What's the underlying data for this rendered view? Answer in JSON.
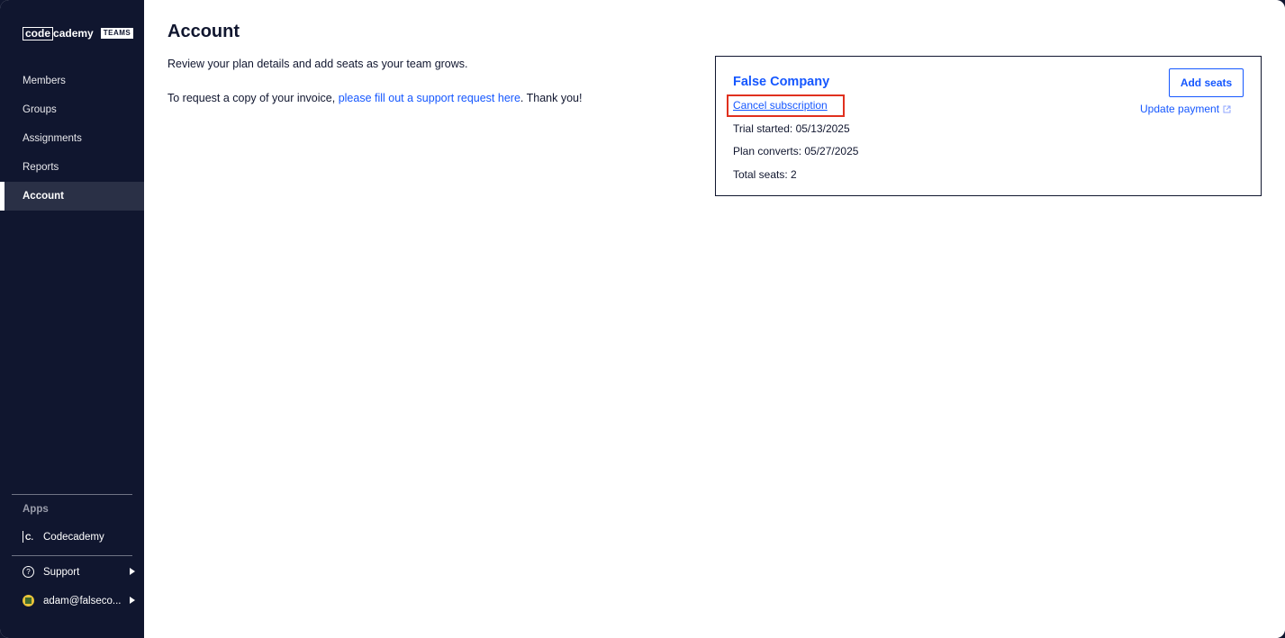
{
  "sidebar": {
    "logo": {
      "code": "code",
      "cademy": "cademy",
      "badge": "TEAMS"
    },
    "nav": [
      {
        "label": "Members"
      },
      {
        "label": "Groups"
      },
      {
        "label": "Assignments"
      },
      {
        "label": "Reports"
      },
      {
        "label": "Account",
        "active": true
      }
    ],
    "apps_heading": "Apps",
    "apps": [
      {
        "label": "Codecademy",
        "icon": "codecademy-icon"
      }
    ],
    "support": {
      "label": "Support",
      "icon": "help-circle-icon"
    },
    "user": {
      "label": "adam@falseco...",
      "icon": "avatar"
    }
  },
  "main": {
    "title": "Account",
    "description": "Review your plan details and add seats as your team grows.",
    "invoice": {
      "prefix": "To request a copy of your invoice, ",
      "link": "please fill out a support request here",
      "suffix": ". Thank you!"
    }
  },
  "card": {
    "company": "False Company",
    "cancel_label": "Cancel subscription",
    "trial_started": "Trial started: 05/13/2025",
    "plan_converts": "Plan converts: 05/27/2025",
    "total_seats": "Total seats: 2",
    "add_seats_label": "Add seats",
    "update_payment_label": "Update payment"
  },
  "colors": {
    "sidebar_bg": "#10162f",
    "accent": "#1557ff",
    "highlight": "#e0301e"
  }
}
